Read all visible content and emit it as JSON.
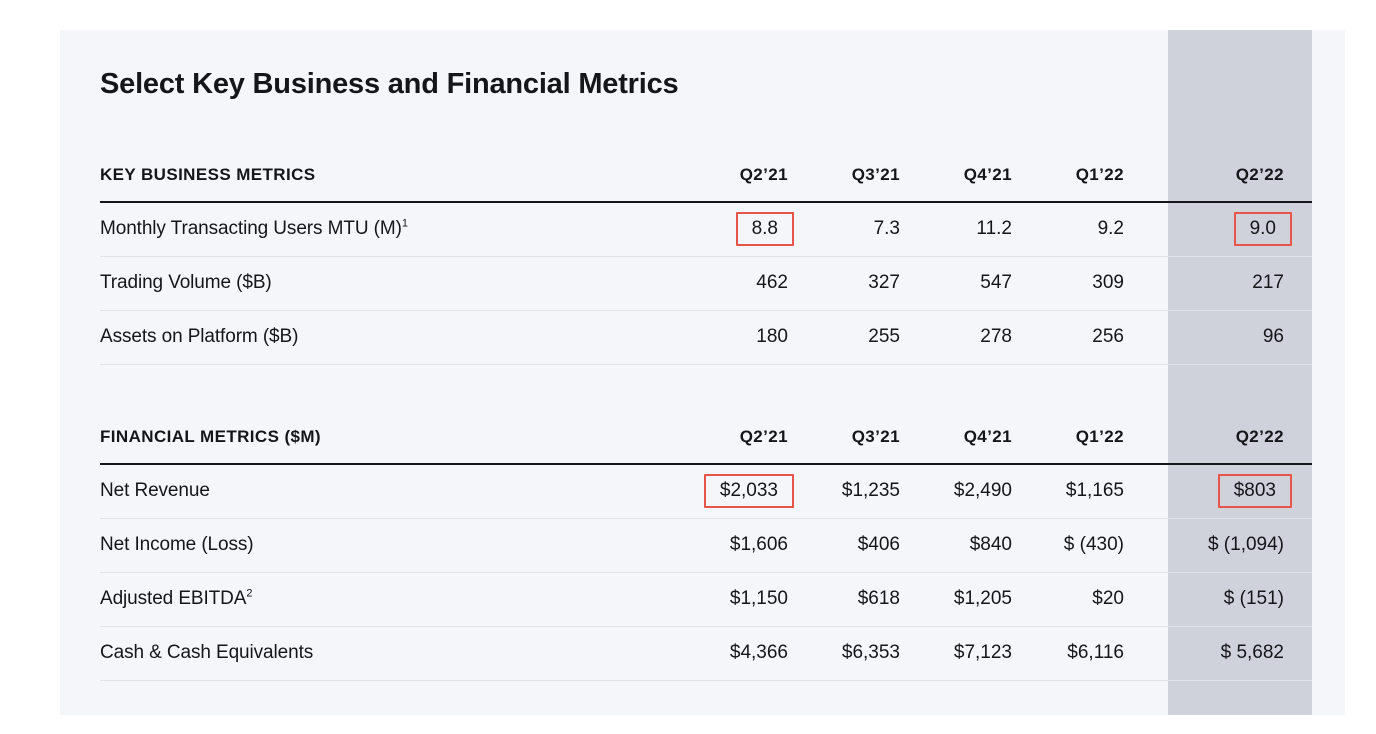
{
  "page": {
    "title": "Select Key Business and Financial Metrics",
    "accent_red": "#e8534a",
    "card_bg": "#f5f6fa",
    "highlight_column_bg": "#d0d2db",
    "text_color": "#14161a",
    "highlighted_column": "Q2'22"
  },
  "chart_data": {
    "type": "table",
    "title": "Select Key Business and Financial Metrics",
    "sections": [
      {
        "header": "KEY BUSINESS METRICS",
        "columns": [
          "Q2’21",
          "Q3’21",
          "Q4’21",
          "Q1’22",
          "Q2’22"
        ],
        "rows": [
          {
            "label": "Monthly Transacting Users MTU (M)",
            "footnote": "1",
            "values": [
              "8.8",
              "7.3",
              "11.2",
              "9.2",
              "9.0"
            ],
            "boxed": [
              true,
              false,
              false,
              false,
              true
            ]
          },
          {
            "label": "Trading Volume ($B)",
            "footnote": "",
            "values": [
              "462",
              "327",
              "547",
              "309",
              "217"
            ],
            "boxed": [
              false,
              false,
              false,
              false,
              false
            ]
          },
          {
            "label": "Assets on Platform ($B)",
            "footnote": "",
            "values": [
              "180",
              "255",
              "278",
              "256",
              "96"
            ],
            "boxed": [
              false,
              false,
              false,
              false,
              false
            ]
          }
        ]
      },
      {
        "header": "FINANCIAL METRICS ($M)",
        "columns": [
          "Q2’21",
          "Q3’21",
          "Q4’21",
          "Q1’22",
          "Q2’22"
        ],
        "rows": [
          {
            "label": "Net Revenue",
            "footnote": "",
            "values": [
              "$2,033",
              "$1,235",
              "$2,490",
              "$1,165",
              "$803"
            ],
            "boxed": [
              true,
              false,
              false,
              false,
              true
            ]
          },
          {
            "label": "Net Income (Loss)",
            "footnote": "",
            "values": [
              "$1,606",
              "$406",
              "$840",
              "$ (430)",
              "$ (1,094)"
            ],
            "boxed": [
              false,
              false,
              false,
              false,
              false
            ]
          },
          {
            "label": "Adjusted EBITDA",
            "footnote": "2",
            "values": [
              "$1,150",
              "$618",
              "$1,205",
              "$20",
              "$  (151)"
            ],
            "boxed": [
              false,
              false,
              false,
              false,
              false
            ]
          },
          {
            "label": "Cash & Cash Equivalents",
            "footnote": "",
            "values": [
              "$4,366",
              "$6,353",
              "$7,123",
              "$6,116",
              "$  5,682"
            ],
            "boxed": [
              false,
              false,
              false,
              false,
              false
            ]
          }
        ]
      }
    ]
  }
}
